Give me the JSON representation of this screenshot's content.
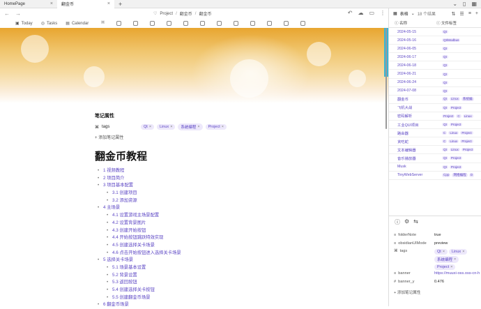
{
  "tabs": [
    {
      "label": "HomePage",
      "active": false
    },
    {
      "label": "翻金币",
      "active": true
    }
  ],
  "breadcrumb": [
    "Project",
    "翻金币",
    "翻金币"
  ],
  "toolbar": {
    "today": "Today",
    "tasks": "Tasks",
    "calendar": "Calendar",
    "heading": "H"
  },
  "right_panel": {
    "view": "表格",
    "count": "18 个结果"
  },
  "table": {
    "col_name": "名称",
    "col_tags": "文件标签",
    "rows": [
      {
        "name": "2024-05-15",
        "tags": [
          "Qt"
        ]
      },
      {
        "name": "2024-05-16",
        "tags": [
          "Qt/Modbus"
        ]
      },
      {
        "name": "2024-06-05",
        "tags": [
          "Qt"
        ]
      },
      {
        "name": "2024-06-17",
        "tags": [
          "Qt"
        ]
      },
      {
        "name": "2024-06-18",
        "tags": [
          "Qt"
        ]
      },
      {
        "name": "2024-06-21",
        "tags": [
          "Qt"
        ]
      },
      {
        "name": "2024-06-24",
        "tags": [
          "Qt"
        ]
      },
      {
        "name": "2024-07-08",
        "tags": [
          "Qt"
        ]
      },
      {
        "name": "翻金币",
        "tags": [
          "Qt",
          "Linux",
          "系统编"
        ]
      },
      {
        "name": "飞机大战",
        "tags": [
          "Qt",
          "Project"
        ]
      },
      {
        "name": "密码解析",
        "tags": [
          "Project",
          "C",
          "Linux"
        ]
      },
      {
        "name": "工业QUI项目",
        "tags": [
          "Qt",
          "Project"
        ]
      },
      {
        "name": "路由器",
        "tags": [
          "C",
          "Linux",
          "Project"
        ]
      },
      {
        "name": "贪吃蛇",
        "tags": [
          "C",
          "Linux",
          "Project"
        ]
      },
      {
        "name": "文本编辑器",
        "tags": [
          "Qt",
          "Linux",
          "Project"
        ]
      },
      {
        "name": "音乐播放器",
        "tags": [
          "Qt",
          "Project"
        ]
      },
      {
        "name": "Musk",
        "tags": [
          "Qt",
          "Project"
        ]
      },
      {
        "name": "TinyWebServer",
        "tags": [
          "Cpp",
          "网络编程",
          "D"
        ]
      }
    ]
  },
  "frontmatter": {
    "folderNote_key": "folderNote",
    "folderNote_val": "true",
    "obsidianUIMode_key": "obsidianUIMode",
    "obsidianUIMode_val": "preview",
    "tags_key": "tags",
    "tags": [
      "Qt",
      "Linux",
      "系统编程",
      "Project"
    ],
    "banner_key": "banner",
    "banner_val": "https://muuxi-oss.oss-cn-h",
    "banner_y_key": "banner_y",
    "banner_y_val": "0.476",
    "add_label": "添加笔记属性"
  },
  "note_props": {
    "heading": "笔记属性",
    "tags_label": "tags",
    "tags": [
      "Qt",
      "Linux",
      "系统编程",
      "Project"
    ],
    "add_label": "添加笔记属性"
  },
  "doc_title": "翻金币教程",
  "toc": [
    {
      "label": "1 视频教程",
      "level": 1
    },
    {
      "label": "2 项目简介",
      "level": 1
    },
    {
      "label": "3 项目基本配置",
      "level": 1
    },
    {
      "label": "3.1 创建项目",
      "level": 2
    },
    {
      "label": "3.2 添加资源",
      "level": 2
    },
    {
      "label": "4 主场景",
      "level": 1
    },
    {
      "label": "4.1 设置游戏主场景配置",
      "level": 2
    },
    {
      "label": "4.2 设置背景图片",
      "level": 2
    },
    {
      "label": "4.3 创建开始按钮",
      "level": 2
    },
    {
      "label": "4.4 开始按钮跳跃特效实现",
      "level": 2
    },
    {
      "label": "4.5 创建选择关卡场景",
      "level": 2
    },
    {
      "label": "4.6 点击开始按钮进入选择关卡场景",
      "level": 2
    },
    {
      "label": "5 选择关卡场景",
      "level": 1
    },
    {
      "label": "5.1 场景基本设置",
      "level": 2
    },
    {
      "label": "5.2 背景设置",
      "level": 2
    },
    {
      "label": "5.3 返回按钮",
      "level": 2
    },
    {
      "label": "5.4 创建选择关卡按钮",
      "level": 2
    },
    {
      "label": "5.5 创建翻金币场景",
      "level": 2
    },
    {
      "label": "6 翻金币场景",
      "level": 1
    }
  ]
}
